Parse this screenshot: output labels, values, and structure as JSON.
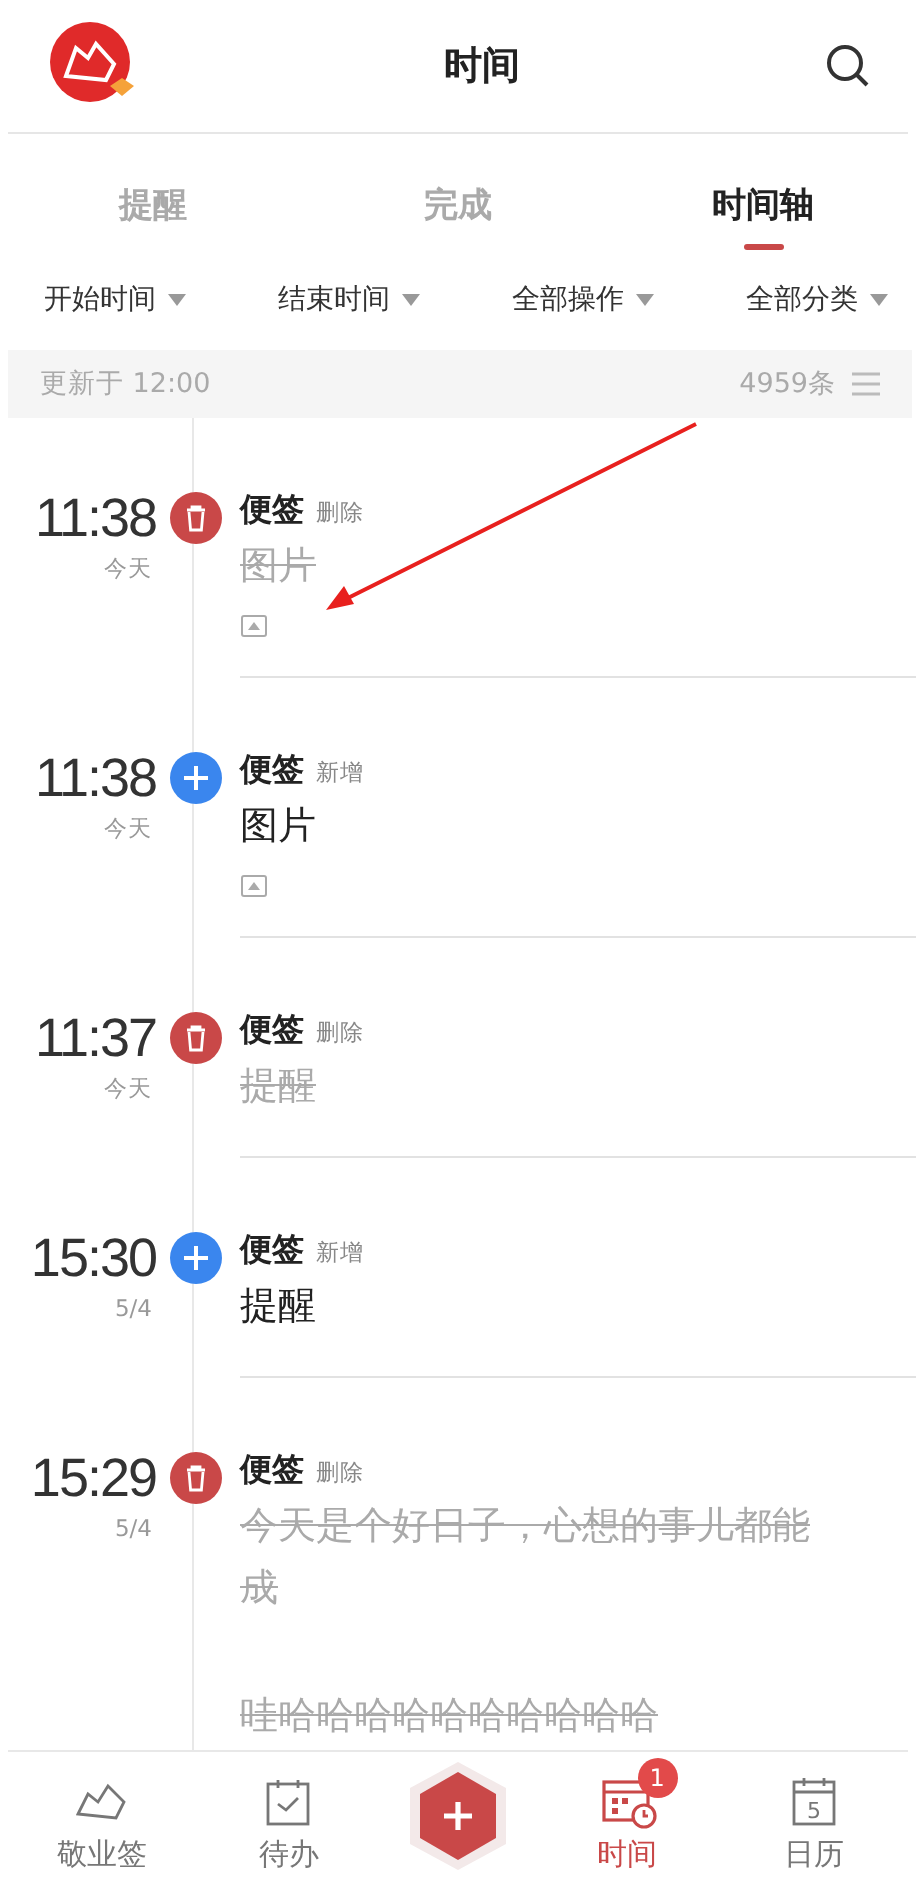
{
  "header": {
    "title": "时间"
  },
  "tabs": [
    {
      "label": "提醒",
      "selected": false
    },
    {
      "label": "完成",
      "selected": false
    },
    {
      "label": "时间轴",
      "selected": true
    }
  ],
  "filters": [
    {
      "label": "开始时间"
    },
    {
      "label": "结束时间"
    },
    {
      "label": "全部操作"
    },
    {
      "label": "全部分类"
    }
  ],
  "update_bar": {
    "text": "更新于 12:00",
    "count": "4959条"
  },
  "entries": [
    {
      "time": "11:38",
      "date": "今天",
      "kind": "delete",
      "category": "便签",
      "action": "删除",
      "lines": [
        "图片"
      ],
      "has_image": true
    },
    {
      "time": "11:38",
      "date": "今天",
      "kind": "add",
      "category": "便签",
      "action": "新增",
      "lines": [
        "图片"
      ],
      "has_image": true
    },
    {
      "time": "11:37",
      "date": "今天",
      "kind": "delete",
      "category": "便签",
      "action": "删除",
      "lines": [
        "提醒"
      ],
      "has_image": false
    },
    {
      "time": "15:30",
      "date": "5/4",
      "kind": "add",
      "category": "便签",
      "action": "新增",
      "lines": [
        "提醒"
      ],
      "has_image": false
    },
    {
      "time": "15:29",
      "date": "5/4",
      "kind": "delete",
      "category": "便签",
      "action": "删除",
      "lines": [
        "今天是个好日子，心想的事儿都能成",
        "哇哈哈哈哈哈哈哈哈哈哈"
      ],
      "has_image": false
    }
  ],
  "nav": [
    {
      "kind": "notes",
      "label": "敬业签",
      "selected": false
    },
    {
      "kind": "todo",
      "label": "待办",
      "selected": false
    },
    {
      "kind": "add"
    },
    {
      "kind": "time",
      "label": "时间",
      "selected": true,
      "badge": "1"
    },
    {
      "kind": "calendar",
      "label": "日历",
      "selected": false,
      "day": "5"
    }
  ]
}
